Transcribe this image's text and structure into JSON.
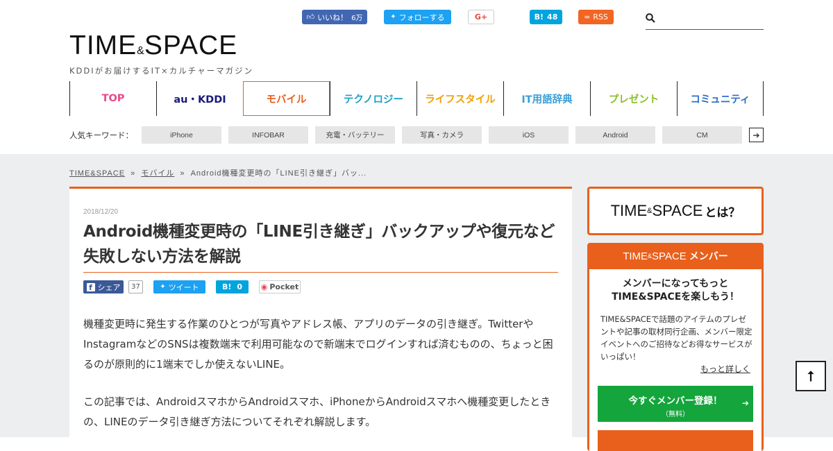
{
  "social": {
    "like_label": "いいね！",
    "like_count": "6万",
    "follow_label": "フォローする",
    "gplus_label": "G+",
    "hatena_label": "B!",
    "hatena_count": "48",
    "rss_label": "RSS"
  },
  "search": {
    "placeholder": ""
  },
  "logo": {
    "main_left": "TIME",
    "main_amp": "&",
    "main_right": "SPACE",
    "tagline": "KDDIがお届けするIT×カルチャーマガジン"
  },
  "nav": [
    {
      "label": "TOP",
      "color": "#e8488c"
    },
    {
      "label": "au・KDDI",
      "color": "#1a1a7a"
    },
    {
      "label": "モバイル",
      "color": "#e8601c"
    },
    {
      "label": "テクノロジー",
      "color": "#1aa0c8"
    },
    {
      "label": "ライフスタイル",
      "color": "#f0a000"
    },
    {
      "label": "IT用語辞典",
      "color": "#3aa0d8"
    },
    {
      "label": "プレゼント",
      "color": "#8ac028"
    },
    {
      "label": "コミュニティ",
      "color": "#2a6ec8"
    }
  ],
  "keywords": {
    "label": "人気キーワード：",
    "tags": [
      "iPhone",
      "INFOBAR",
      "充電・バッテリー",
      "写真・カメラ",
      "iOS",
      "Android",
      "CM"
    ],
    "arrow": "➔"
  },
  "breadcrumb": {
    "home": "TIME&SPACE",
    "category": "モバイル",
    "current": "Android機種変更時の「LINE引き継ぎ」バッ...",
    "sep": "»"
  },
  "article": {
    "date": "2018/12/20",
    "title": "Android機種変更時の「LINE引き継ぎ」バックアップや復元など失敗しない方法を解説",
    "share": {
      "facebook": "シェア",
      "facebook_count": "37",
      "twitter": "ツイート",
      "hatena": "B!",
      "hatena_count": "0",
      "pocket": "Pocket"
    },
    "p1": "機種変更時に発生する作業のひとつが写真やアドレス帳、アプリのデータの引き継ぎ。TwitterやInstagramなどのSNSは複数端末で利用可能なので新端末でログインすれば済むものの、ちょっと困るのが原則的に1端末でしか使えないLINE。",
    "p2": "この記事では、AndroidスマホからAndroidスマホ、iPhoneからAndroidスマホへ機種変更したときの、LINEのデータ引き継ぎ方法についてそれぞれ解説します。"
  },
  "sidebar": {
    "about_brand_left": "TIME",
    "about_brand_amp": "&",
    "about_brand_right": "SPACE",
    "about_q": "とは？",
    "member_brand_left": "TIME",
    "member_brand_amp": "&",
    "member_brand_right": "SPACE",
    "member_label": "メンバー",
    "member_heading_1": "メンバーになってもっと",
    "member_heading_2": "TIME&SPACEを楽しもう！",
    "member_text": "TIME&SPACEで話題のアイテムのプレゼントや記事の取材同行企画、メンバー限定イベントへのご招待などお得なサービスがいっぱい！",
    "member_more": "もっと詳しく",
    "register_label": "今すぐメンバー登録！",
    "register_sub": "（無料）",
    "register_arrow": "➔"
  },
  "to_top": "⭡"
}
